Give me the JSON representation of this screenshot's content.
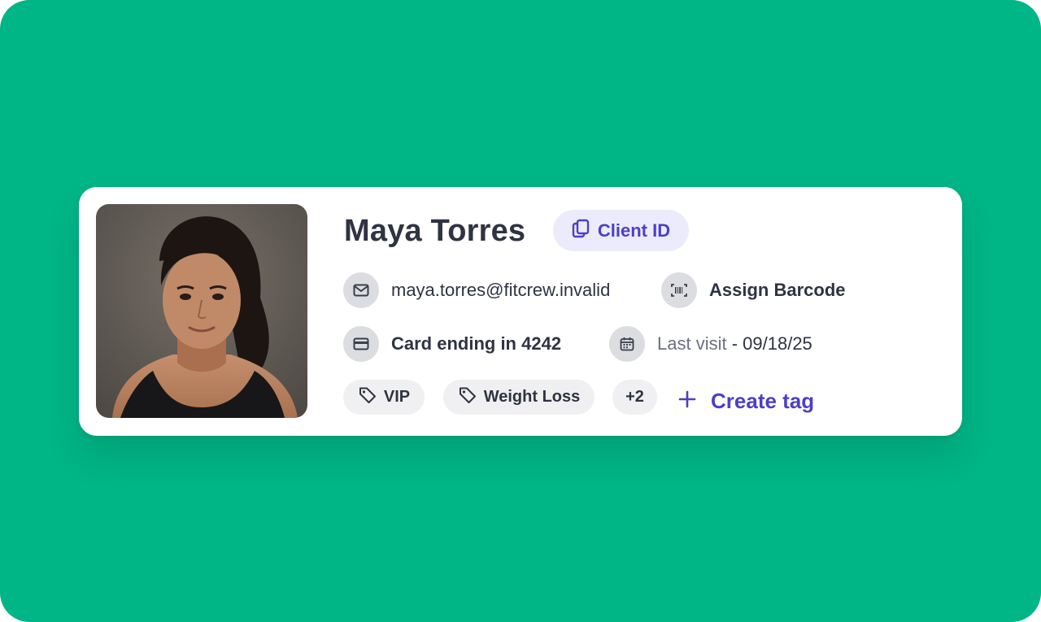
{
  "profile": {
    "name": "Maya Torres",
    "client_id_label": "Client ID",
    "email": "maya.torres@fitcrew.invalid",
    "barcode_label": "Assign Barcode",
    "card_label": "Card ending in 4242",
    "last_visit_label": "Last visit",
    "last_visit_separator": " - ",
    "last_visit_date": "09/18/25"
  },
  "tags": {
    "items": [
      "VIP",
      "Weight Loss"
    ],
    "more_count": "+2",
    "create_label": "Create tag"
  },
  "icons": {
    "client_id": "copy-icon",
    "email": "mail-icon",
    "barcode": "barcode-icon",
    "card": "credit-card-icon",
    "last_visit": "calendar-icon",
    "tag": "tag-icon",
    "create": "plus-icon"
  },
  "colors": {
    "background": "#00b586",
    "accent": "#4b3fc7",
    "accent_bg": "#ecebfb",
    "text": "#2f3342",
    "muted": "#6c7080",
    "icon_circle": "#dcdde1",
    "chip_bg": "#f0f0f2"
  }
}
